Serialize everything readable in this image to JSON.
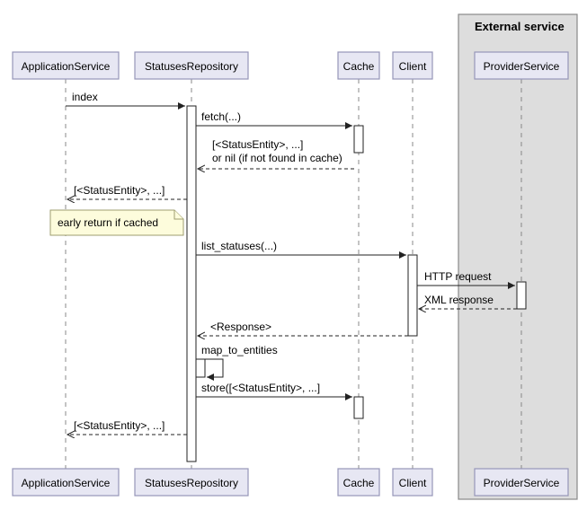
{
  "external_box_label": "External service",
  "participants": {
    "app": "ApplicationService",
    "repo": "StatusesRepository",
    "cache": "Cache",
    "client": "Client",
    "provider": "ProviderService"
  },
  "messages": {
    "m1": "index",
    "m2": "fetch(...)",
    "m3a": "[<StatusEntity>, ...]",
    "m3b": "or nil (if not found in cache)",
    "m4": "[<StatusEntity>, ...]",
    "note1": "early return if cached",
    "m5": "list_statuses(...)",
    "m6": "HTTP request",
    "m7": "XML response",
    "m8": "<Response>",
    "m9": "map_to_entities",
    "m10": "store([<StatusEntity>, ...]",
    "m11": "[<StatusEntity>, ...]"
  }
}
